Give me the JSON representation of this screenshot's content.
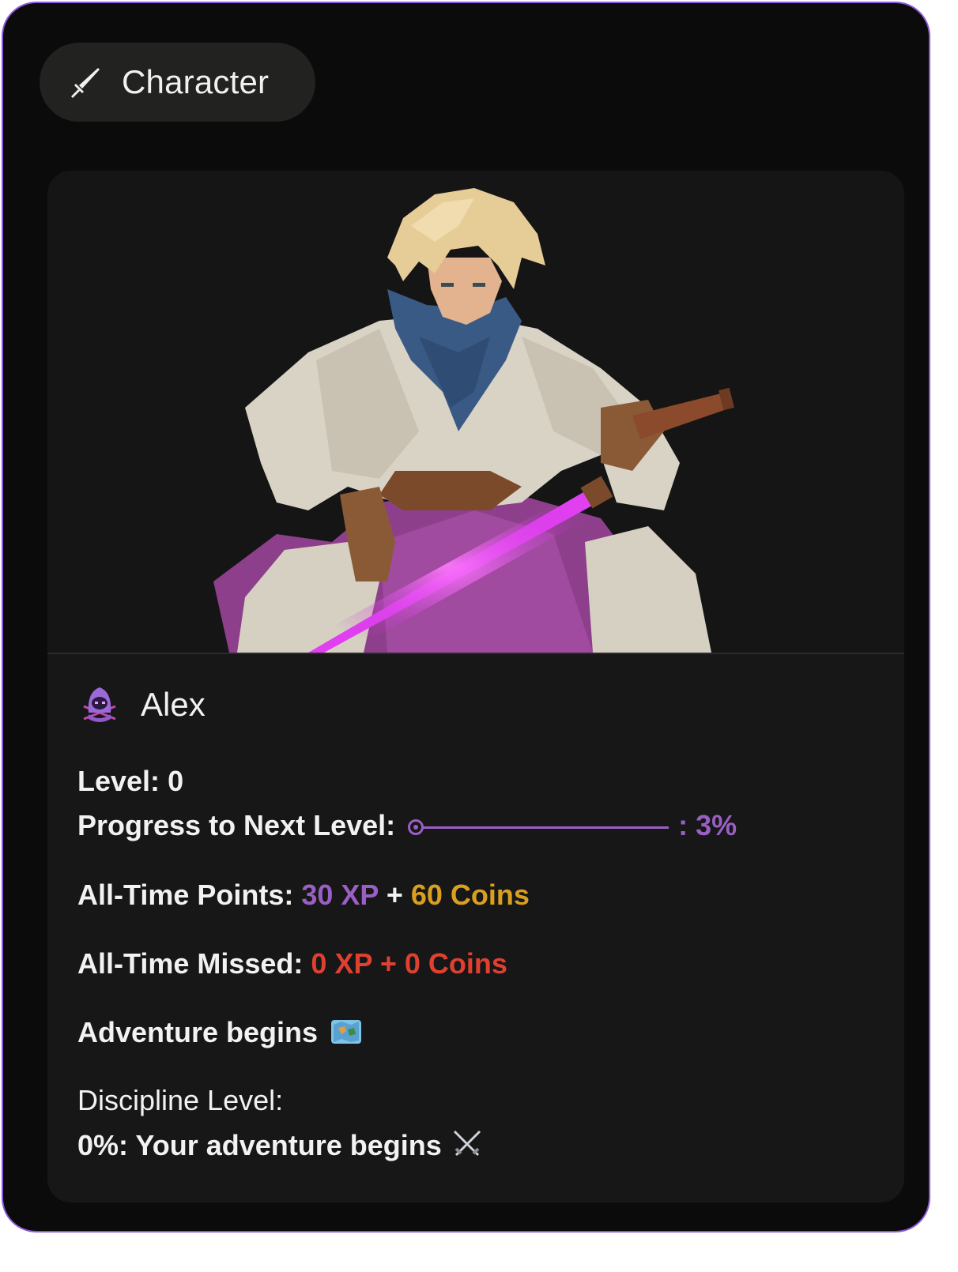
{
  "tab": {
    "label": "Character",
    "icon": "sword-icon"
  },
  "character": {
    "name": "Alex",
    "avatar_icon": "hooded-ninja-icon"
  },
  "stats": {
    "level_label": "Level:",
    "level_value": "0",
    "progress_label": "Progress to Next Level:",
    "progress_percent": 3,
    "progress_text": ": 3%",
    "points_label": "All-Time Points:",
    "points_xp": "30 XP",
    "points_plus": "+",
    "points_coins": "60 Coins",
    "missed_label": "All-Time Missed:",
    "missed_value": "0 XP + 0 Coins",
    "adventure_text": "Adventure begins",
    "adventure_icon": "map-icon",
    "discipline_label": "Discipline Level:",
    "discipline_value": "0%: Your adventure begins",
    "discipline_icon": "crossed-swords-icon"
  },
  "colors": {
    "xp": "#9a5fc4",
    "coins": "#d9a020",
    "missed": "#e04030",
    "frame_border": "#8a5ad6"
  }
}
